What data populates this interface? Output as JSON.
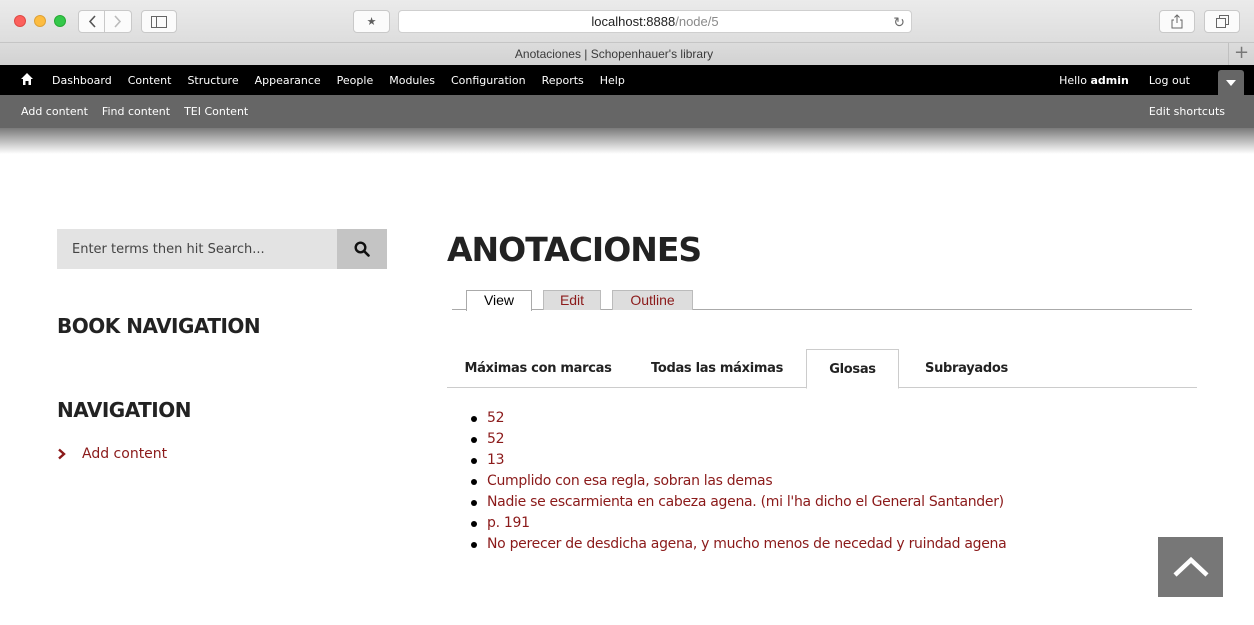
{
  "browser": {
    "url_host": "localhost:8888",
    "url_path": "/node/5",
    "tab_title": "Anotaciones | Schopenhauer's library",
    "new_tab_label": "+"
  },
  "toolbar": {
    "menu": [
      "Dashboard",
      "Content",
      "Structure",
      "Appearance",
      "People",
      "Modules",
      "Configuration",
      "Reports",
      "Help"
    ],
    "hello_prefix": "Hello",
    "username": "admin",
    "logout": "Log out"
  },
  "shortcuts": {
    "items": [
      "Add content",
      "Find content",
      "TEI Content"
    ],
    "edit": "Edit shortcuts"
  },
  "search": {
    "placeholder": "Enter terms then hit Search..."
  },
  "sidebar": {
    "book_navigation_title": "BOOK NAVIGATION",
    "navigation_title": "NAVIGATION",
    "add_content_link": "Add content"
  },
  "main": {
    "title": "ANOTACIONES",
    "primary_tabs": [
      "View",
      "Edit",
      "Outline"
    ],
    "secondary_tabs": [
      "Máximas con marcas",
      "Todas las máximas",
      "Glosas",
      "Subrayados"
    ],
    "active_secondary_tab": "Glosas",
    "results": [
      "52",
      "52",
      "13",
      "Cumplido con esa regla, sobran las demas",
      "Nadie se escarmienta en cabeza agena. (mi l'ha dicho el General Santander)",
      "p. 191",
      "No perecer de desdicha agena, y mucho menos de necedad y ruindad agena"
    ]
  },
  "colors": {
    "link": "#8b1a1a",
    "toolbar_bg": "#000000",
    "shortcuts_bg": "#666666",
    "back_to_top_bg": "#777777"
  },
  "icons": {
    "home": "home-icon",
    "search": "search-icon",
    "chevron": "chevron-right-icon",
    "back_to_top": "chevron-up-icon"
  }
}
